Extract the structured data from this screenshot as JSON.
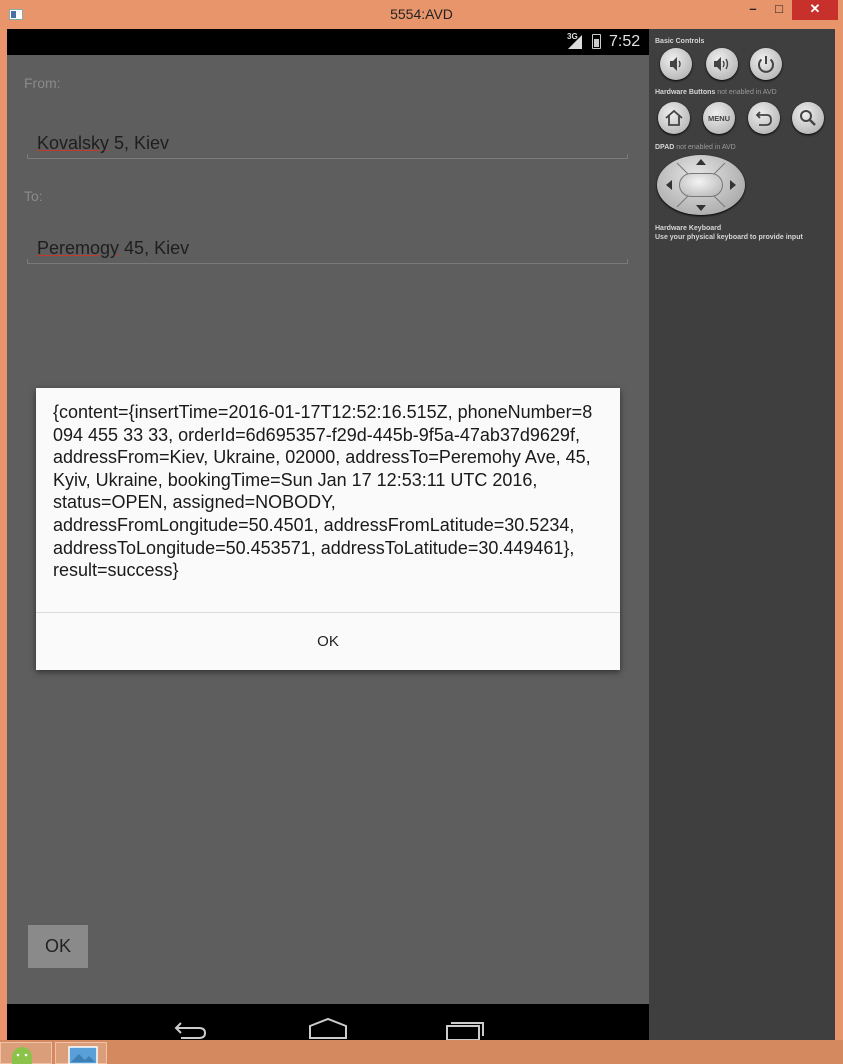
{
  "window": {
    "title": "5554:AVD",
    "minimize_label": "–",
    "maximize_label": "□",
    "close_label": "✕"
  },
  "status_bar": {
    "network": "3G",
    "time": "7:52"
  },
  "form": {
    "from_label": "From:",
    "from_value_underlined": "Kovalsky",
    "from_value_rest": " 5, Kiev",
    "to_label": "To:",
    "to_value_underlined": "Peremogy",
    "to_value_rest": " 45, Kiev",
    "ok_label": "OK"
  },
  "dialog": {
    "message": "{content={insertTime=2016-01-17T12:52:16.515Z, phoneNumber=8 094 455 33 33, orderId=6d695357-f29d-445b-9f5a-47ab37d9629f, addressFrom=Kiev, Ukraine, 02000, addressTo=Peremohy Ave, 45, Kyiv, Ukraine, bookingTime=Sun Jan 17 12:53:11 UTC 2016, status=OPEN, assigned=NOBODY, addressFromLongitude=50.4501, addressFromLatitude=30.5234, addressToLongitude=50.453571, addressToLatitude=30.449461}, result=success}",
    "ok_label": "OK"
  },
  "nav_bar": {
    "icons": [
      "back-icon",
      "home-icon",
      "recent-apps-icon"
    ]
  },
  "controls_panel": {
    "basic_controls_label": "Basic Controls",
    "hardware_buttons_label": "Hardware Buttons",
    "hardware_buttons_note": "not enabled in AVD",
    "menu_label": "MENU",
    "dpad_label": "DPAD",
    "dpad_note": "not enabled in AVD",
    "keyboard_label": "Hardware Keyboard",
    "keyboard_note": "Use your physical keyboard to provide input"
  },
  "taskbar": {
    "items": [
      "android-icon",
      "image-viewer-icon"
    ]
  }
}
